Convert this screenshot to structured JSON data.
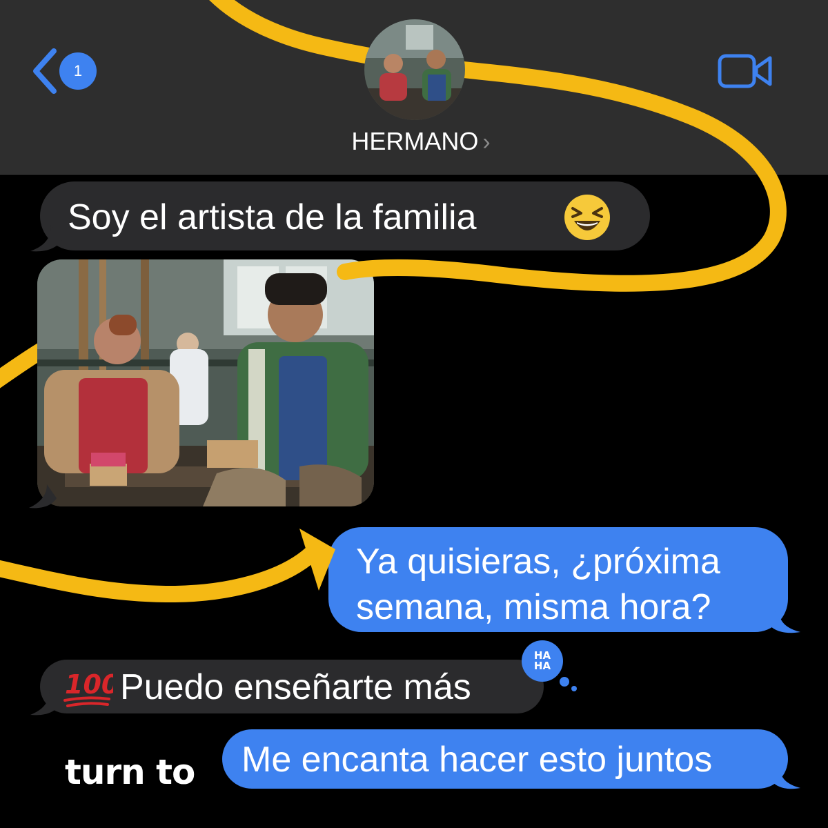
{
  "header": {
    "back_badge_count": "1",
    "contact_name": "HERMANO",
    "chevron_glyph": "›",
    "video_icon": "video-camera-icon",
    "accent_color": "#3e82f0"
  },
  "messages": [
    {
      "side": "received",
      "text": "Soy el artista de la familia",
      "emoji": "laughing-face-emoji"
    },
    {
      "side": "received",
      "type": "photo",
      "image": "workshop-photo"
    },
    {
      "side": "sent",
      "lines": [
        "Ya quisieras, ¿próxima",
        "semana, misma hora?"
      ]
    },
    {
      "side": "received",
      "text": "Puedo enseñarte más",
      "emoji": "hundred-points-emoji",
      "tapback_lines": [
        "HA",
        "HA"
      ]
    },
    {
      "side": "sent",
      "text": "Me encanta hacer esto juntos"
    }
  ],
  "brand": {
    "logo_text": "turn to"
  },
  "colors": {
    "ribbon": "#f5b914",
    "received_bubble": "#2b2b2d",
    "sent_bubble": "#3e82f0"
  }
}
